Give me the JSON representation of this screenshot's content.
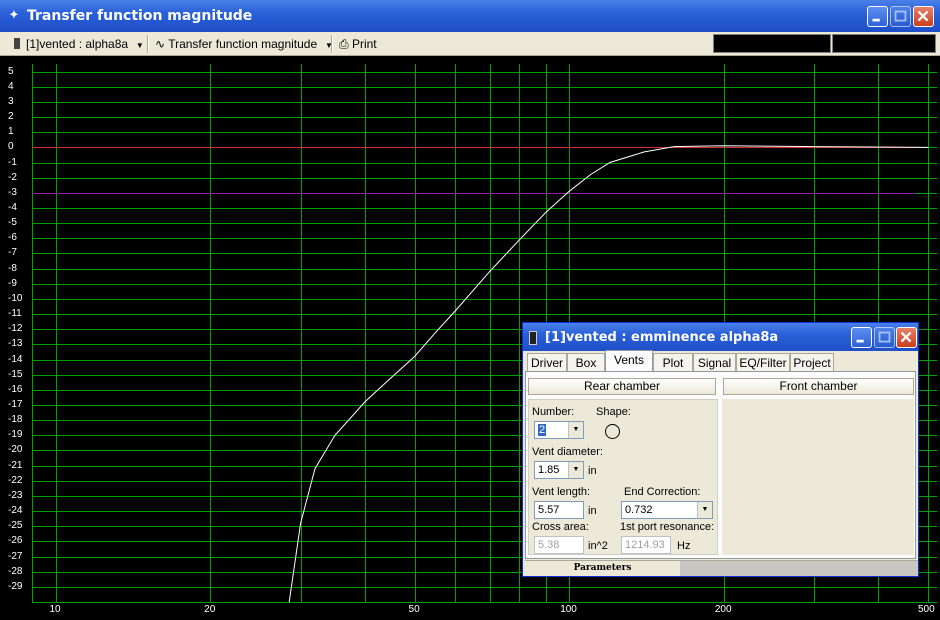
{
  "window": {
    "title": "Transfer function magnitude"
  },
  "toolbar": {
    "project_select": "[1]vented : alpha8a",
    "graph_select": "Transfer function magnitude",
    "print_label": "Print"
  },
  "dialog": {
    "title": "[1]vented : emminence alpha8a",
    "tabs": [
      "Driver",
      "Box",
      "Vents",
      "Plot",
      "Signal",
      "EQ/Filter",
      "Project"
    ],
    "active_tab": "Vents",
    "rear_chamber_label": "Rear chamber",
    "front_chamber_label": "Front chamber",
    "number_label": "Number:",
    "number_value": "2",
    "shape_label": "Shape:",
    "vent_diameter_label": "Vent diameter:",
    "vent_diameter_value": "1.85",
    "vent_diameter_unit": "in",
    "vent_length_label": "Vent length:",
    "vent_length_value": "5.57",
    "vent_length_unit": "in",
    "end_correction_label": "End Correction:",
    "end_correction_value": "0.732",
    "cross_area_label": "Cross area:",
    "cross_area_value": "5.38",
    "cross_area_unit": "in^2",
    "port_resonance_label": "1st port resonance:",
    "port_resonance_value": "1214.93",
    "port_resonance_unit": "Hz",
    "status_tab": "Parameters"
  },
  "chart_data": {
    "type": "line",
    "x_scale": "log",
    "xlim": [
      9,
      520
    ],
    "ylim": [
      -30,
      5.5
    ],
    "x_ticks": [
      10,
      20,
      50,
      100,
      200,
      500
    ],
    "y_ticks": [
      5,
      4,
      3,
      2,
      1,
      0,
      -1,
      -2,
      -3,
      -4,
      -5,
      -6,
      -7,
      -8,
      -9,
      -10,
      -11,
      -12,
      -13,
      -14,
      -15,
      -16,
      -17,
      -18,
      -19,
      -20,
      -21,
      -22,
      -23,
      -24,
      -25,
      -26,
      -27,
      -28,
      -29
    ],
    "grid": true,
    "colors": {
      "background": "#000000",
      "grid": "#00a000",
      "curve": "#ffffff",
      "reference_zero": "#d03030",
      "reference_minus3": "#9020a0"
    },
    "reference_lines": [
      0,
      -3
    ],
    "series": [
      {
        "x": [
          28.5,
          30,
          32,
          35,
          40,
          45,
          50,
          55,
          60,
          70,
          80,
          90,
          100,
          110,
          120,
          140,
          160,
          200,
          300,
          500
        ],
        "y": [
          -30,
          -24.8,
          -21.2,
          -19,
          -16.8,
          -15.2,
          -13.8,
          -12.2,
          -10.8,
          -8.2,
          -6.1,
          -4.3,
          -2.9,
          -1.8,
          -1.0,
          -0.3,
          0.05,
          0.1,
          0.05,
          0.0
        ]
      }
    ]
  }
}
